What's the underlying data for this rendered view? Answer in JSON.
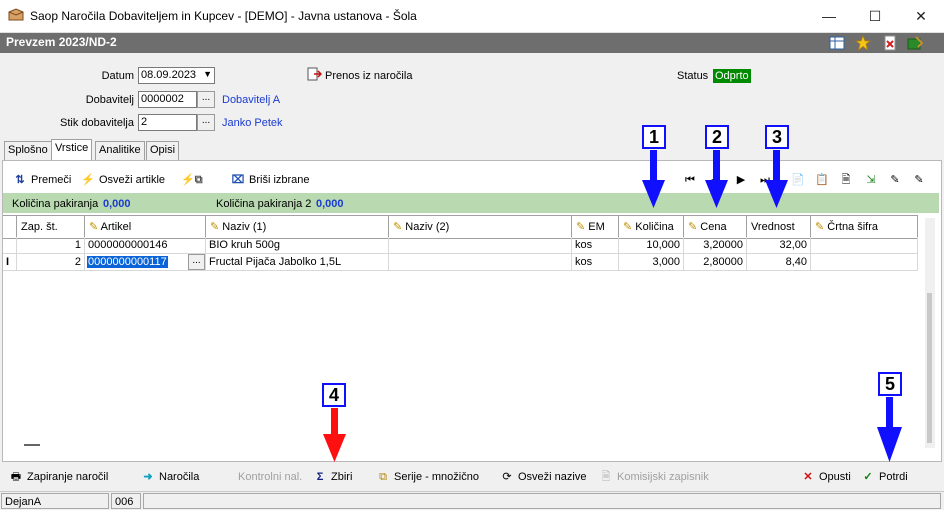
{
  "window": {
    "title": "Saop  Naročila Dobaviteljem in Kupcev - [DEMO] - Javna ustanova - Šola",
    "minimize": "—",
    "maximize": "☐",
    "close": "✕"
  },
  "document": {
    "title": "Prevzem 2023/ND-2"
  },
  "form": {
    "datum_label": "Datum",
    "datum_value": "08.09.2023",
    "dobavitelj_label": "Dobavitelj",
    "dobavitelj_value": "0000002",
    "dobavitelj_name": "Dobavitelj A",
    "stik_label": "Stik dobavitelja",
    "stik_value": "2",
    "stik_name": "Janko Petek",
    "prenos_label": "Prenos iz naročila",
    "status_label": "Status",
    "status_value": "Odprto",
    "status_color": "#008a00"
  },
  "tabs": [
    "Splošno",
    "Vrstice",
    "Analitike",
    "Opisi"
  ],
  "toolbar": {
    "premeci": "Premeči",
    "osvezi_artikle": "Osveži artikle",
    "brisi_izbrane": "Briši izbrane"
  },
  "quantities": {
    "kol_pak_label": "Količina pakiranja",
    "kol_pak_value": "0,000",
    "kol_pak2_label": "Količina pakiranja 2",
    "kol_pak2_value": "0,000"
  },
  "grid": {
    "columns": [
      "Zap. št.",
      "Artikel",
      "Naziv (1)",
      "Naziv (2)",
      "EM",
      "Količina",
      "Cena",
      "Vrednost",
      "Črtna šifra"
    ],
    "rows": [
      {
        "zap": "1",
        "artikel": "0000000000146",
        "naziv1": "BIO kruh 500g",
        "naziv2": "",
        "em": "kos",
        "kolicina": "10,000",
        "cena": "3,20000",
        "vrednost": "32,00",
        "crtna": ""
      },
      {
        "zap": "2",
        "artikel": "0000000000117",
        "naziv1": "Fructal Pijača Jabolko 1,5L",
        "naziv2": "",
        "em": "kos",
        "kolicina": "3,000",
        "cena": "2,80000",
        "vrednost": "8,40",
        "crtna": ""
      }
    ],
    "row_indicator": "I",
    "cell_button": "..."
  },
  "bottom": {
    "zapiranje": "Zapiranje naročil",
    "narocila": "Naročila",
    "kontrolni": "Kontrolni nal.",
    "zbiri": "Zbiri",
    "serije": "Serije - množično",
    "osvezi_nazive": "Osveži nazive",
    "komisijski": "Komisijski zapisnik",
    "opusti": "Opusti",
    "potrdi": "Potrdi"
  },
  "statusbar": {
    "user": "DejanA",
    "code": "006"
  },
  "markers": [
    "1",
    "2",
    "3",
    "4",
    "5"
  ],
  "colors": {
    "marker_blue": "#1010ff",
    "marker_red": "#ff1010",
    "qty_bar": "#b9d9b0"
  }
}
